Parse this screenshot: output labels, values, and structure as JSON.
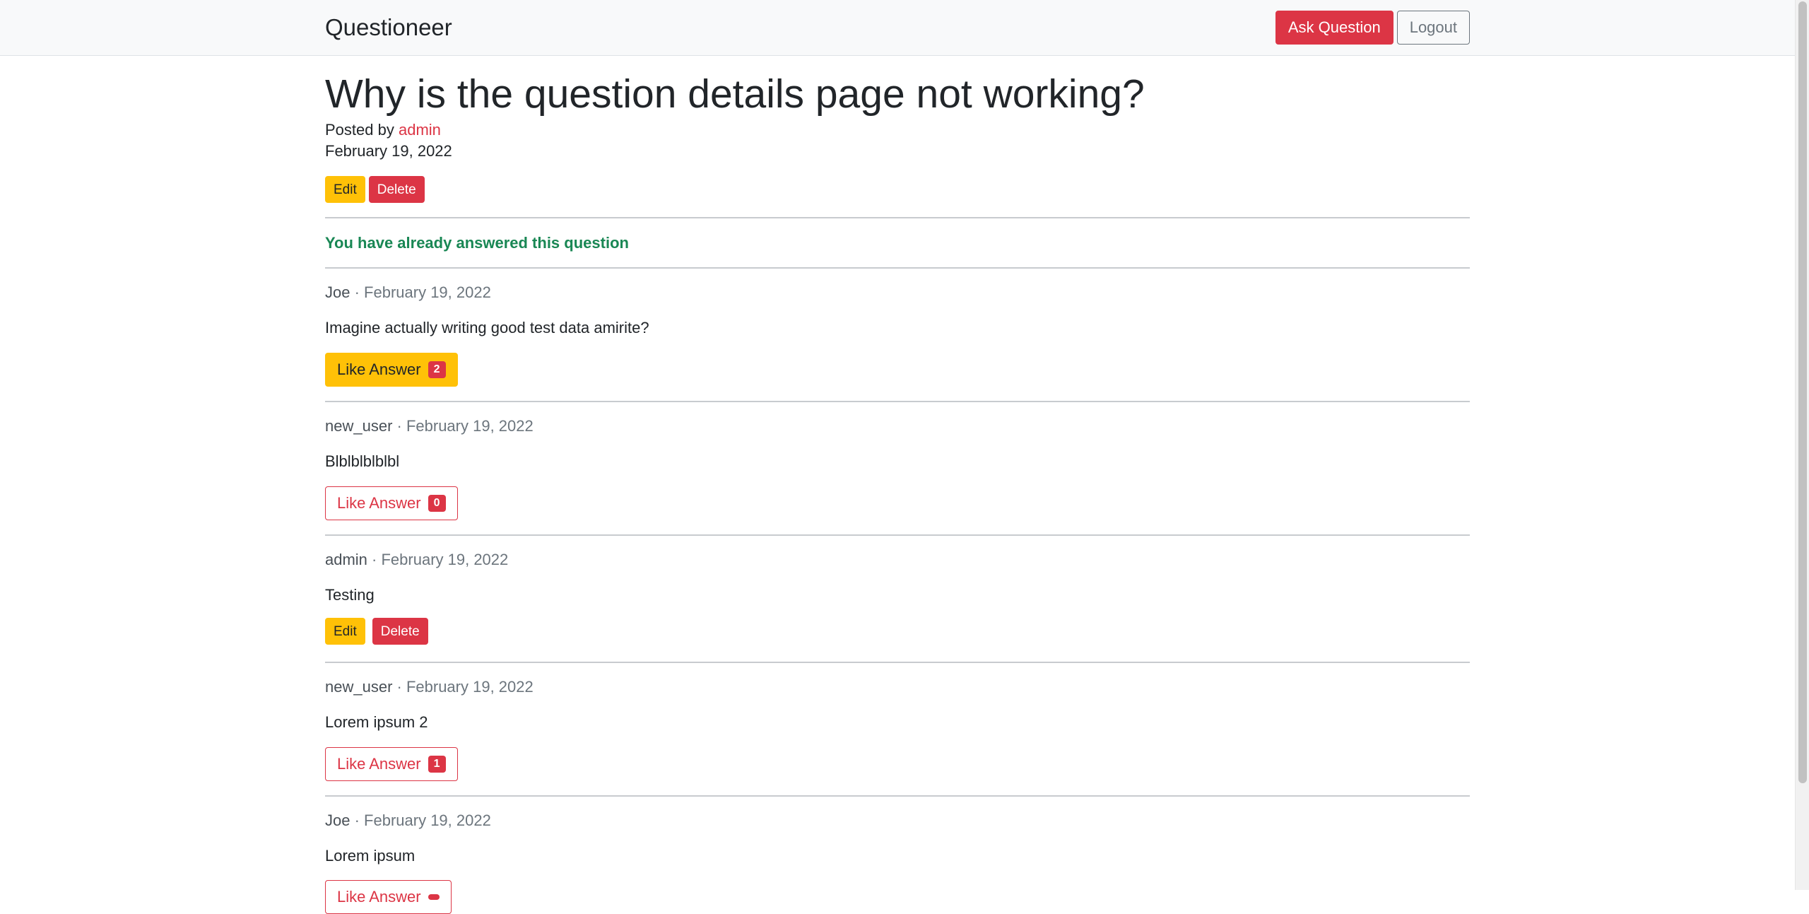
{
  "navbar": {
    "brand": "Questioneer",
    "ask_label": "Ask Question",
    "logout_label": "Logout"
  },
  "question": {
    "title": "Why is the question details page not working?",
    "posted_by_prefix": "Posted by",
    "author": "admin",
    "date": "February 19, 2022",
    "edit_label": "Edit",
    "delete_label": "Delete"
  },
  "answered_note": "You have already answered this question",
  "answers": [
    {
      "user": "Joe",
      "date": "· February 19, 2022",
      "body": "Imagine actually writing good test data amirite?",
      "like_label": "Like Answer",
      "like_count": "2",
      "liked": true
    },
    {
      "user": "new_user",
      "date": "· February 19, 2022",
      "body": "Blblblblblbl",
      "like_label": "Like Answer",
      "like_count": "0",
      "liked": false
    },
    {
      "user": "admin",
      "date": "· February 19, 2022",
      "body": "Testing",
      "edit_label": "Edit",
      "delete_label": "Delete"
    },
    {
      "user": "new_user",
      "date": "· February 19, 2022",
      "body": "Lorem ipsum 2",
      "like_label": "Like Answer",
      "like_count": "1",
      "liked": false
    },
    {
      "user": "Joe",
      "date": "· February 19, 2022",
      "body": "Lorem ipsum",
      "like_label": "Like Answer",
      "like_count": "",
      "liked": false
    }
  ],
  "colors": {
    "primary_red": "#dc3545",
    "warning_yellow": "#ffc107",
    "success_green": "#198754",
    "navbar_bg": "#f8f9fa"
  }
}
